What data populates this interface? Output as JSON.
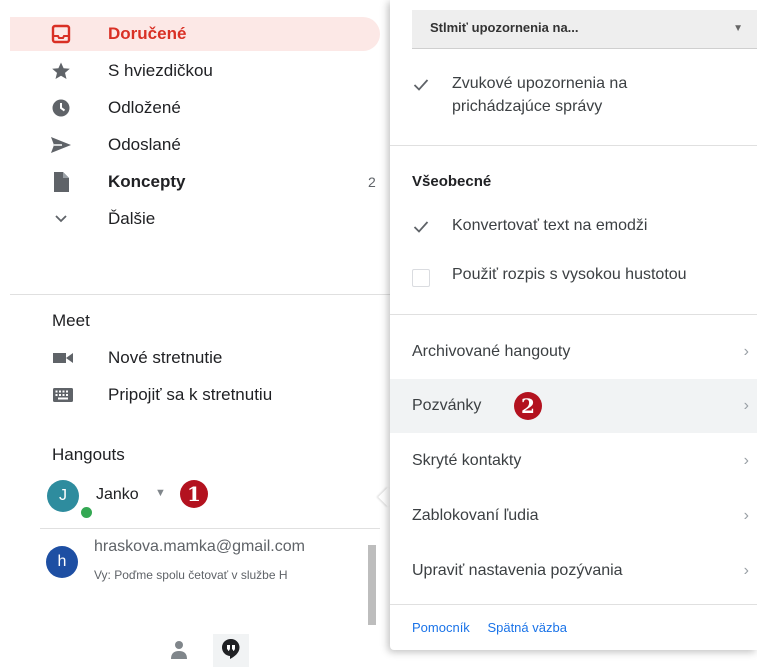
{
  "sidebar": {
    "items": [
      {
        "label": "Doručené",
        "icon": "inbox-icon",
        "count": ""
      },
      {
        "label": "S hviezdičkou",
        "icon": "star-icon",
        "count": ""
      },
      {
        "label": "Odložené",
        "icon": "clock-icon",
        "count": ""
      },
      {
        "label": "Odoslané",
        "icon": "send-icon",
        "count": ""
      },
      {
        "label": "Koncepty",
        "icon": "draft-icon",
        "count": "2"
      },
      {
        "label": "Ďalšie",
        "icon": "chevron-down-icon",
        "count": ""
      }
    ],
    "meet": {
      "title": "Meet",
      "items": [
        {
          "label": "Nové stretnutie",
          "icon": "video-camera-icon"
        },
        {
          "label": "Pripojiť sa k stretnutiu",
          "icon": "keyboard-icon"
        }
      ]
    },
    "hangouts": {
      "title": "Hangouts",
      "user": {
        "initial": "J",
        "name": "Janko",
        "avatar_color": "#2e8c9e",
        "status_color": "#34a853"
      },
      "conversation": {
        "initial": "h",
        "email": "hraskova.mamka@gmail.com",
        "preview": "Vy: Poďme spolu četovať v službe H",
        "avatar_color": "#1e4fa3"
      }
    },
    "markers": [
      "1"
    ]
  },
  "panel": {
    "select_label": "Stlmiť upozornenia na...",
    "sound_notifications": {
      "label_line1": "Zvukové upozornenia na",
      "label_line2": "prichádzajúce správy",
      "checked": true
    },
    "general_title": "Všeobecné",
    "convert_emoji": {
      "label": "Konvertovať text na emodži",
      "checked": true
    },
    "high_density": {
      "label": "Použiť rozpis s vysokou hustotou",
      "checked": false
    },
    "menu": [
      {
        "label": "Archivované hangouty"
      },
      {
        "label": "Pozvánky",
        "marker": "2"
      },
      {
        "label": "Skryté kontakty"
      },
      {
        "label": "Zablokovaní ľudia"
      },
      {
        "label": "Upraviť nastavenia pozývania"
      }
    ],
    "footer": {
      "help": "Pomocník",
      "feedback": "Spätná väzba"
    }
  },
  "colors": {
    "accent_red": "#d93025",
    "marker_red": "#b3121f",
    "link_blue": "#1a73e8"
  }
}
